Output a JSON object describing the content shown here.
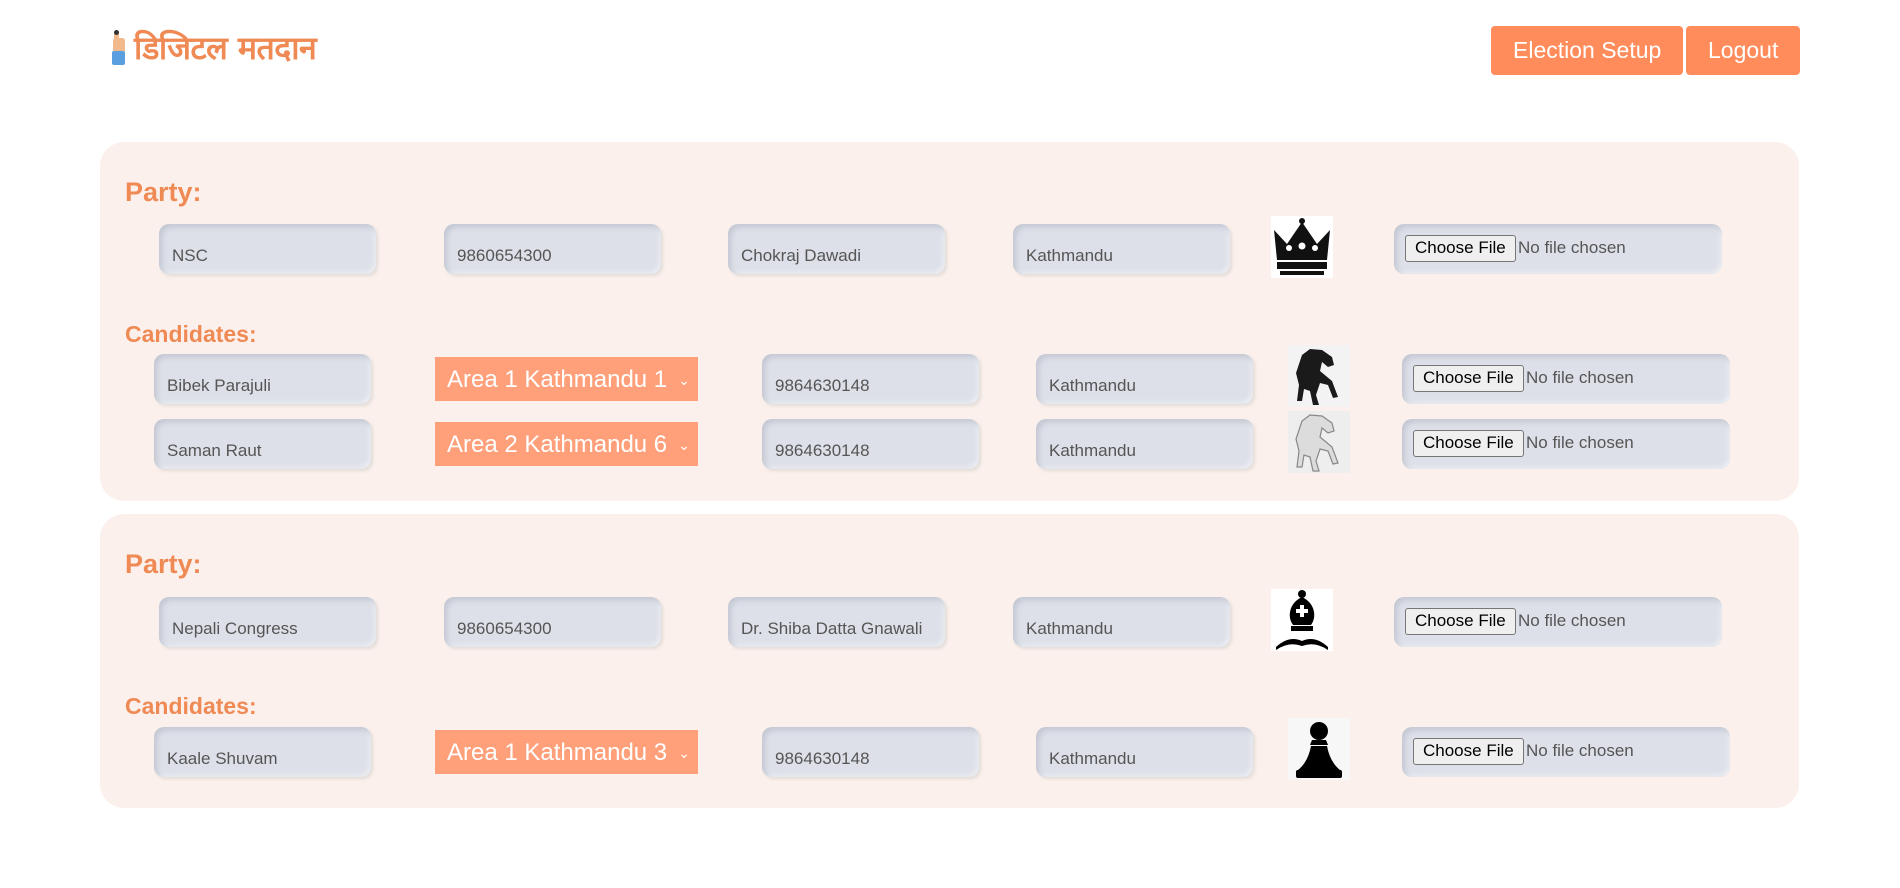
{
  "header": {
    "logo_text": "डिजिटल मतदान",
    "election_setup_label": "Election Setup",
    "logout_label": "Logout"
  },
  "labels": {
    "party": "Party:",
    "candidates": "Candidates:"
  },
  "file_input": {
    "button": "Choose File",
    "status": "No file chosen"
  },
  "parties": [
    {
      "name": "NSC",
      "phone": "9860654300",
      "leader": "Chokraj Dawadi",
      "address": "Kathmandu",
      "symbol": "crown-icon",
      "candidates": [
        {
          "name": "Bibek Parajuli",
          "area": "Area 1 Kathmandu 1",
          "phone": "9864630148",
          "address": "Kathmandu",
          "symbol": "black-horse-icon"
        },
        {
          "name": "Saman Raut",
          "area": "Area 2 Kathmandu 6",
          "phone": "9864630148",
          "address": "Kathmandu",
          "symbol": "white-horse-icon"
        }
      ]
    },
    {
      "name": "Nepali Congress",
      "phone": "9860654300",
      "leader": "Dr. Shiba Datta Gnawali",
      "address": "Kathmandu",
      "symbol": "chess-bishop-icon",
      "candidates": [
        {
          "name": "Kaale Shuvam",
          "area": "Area 1 Kathmandu 3",
          "phone": "9864630148",
          "address": "Kathmandu",
          "symbol": "chess-pawn-icon"
        }
      ]
    }
  ],
  "colors": {
    "accent": "#ff8c5a",
    "card_bg": "#fbf0ec",
    "field_bg": "#dde0e8",
    "select_bg": "#ffa07a"
  }
}
